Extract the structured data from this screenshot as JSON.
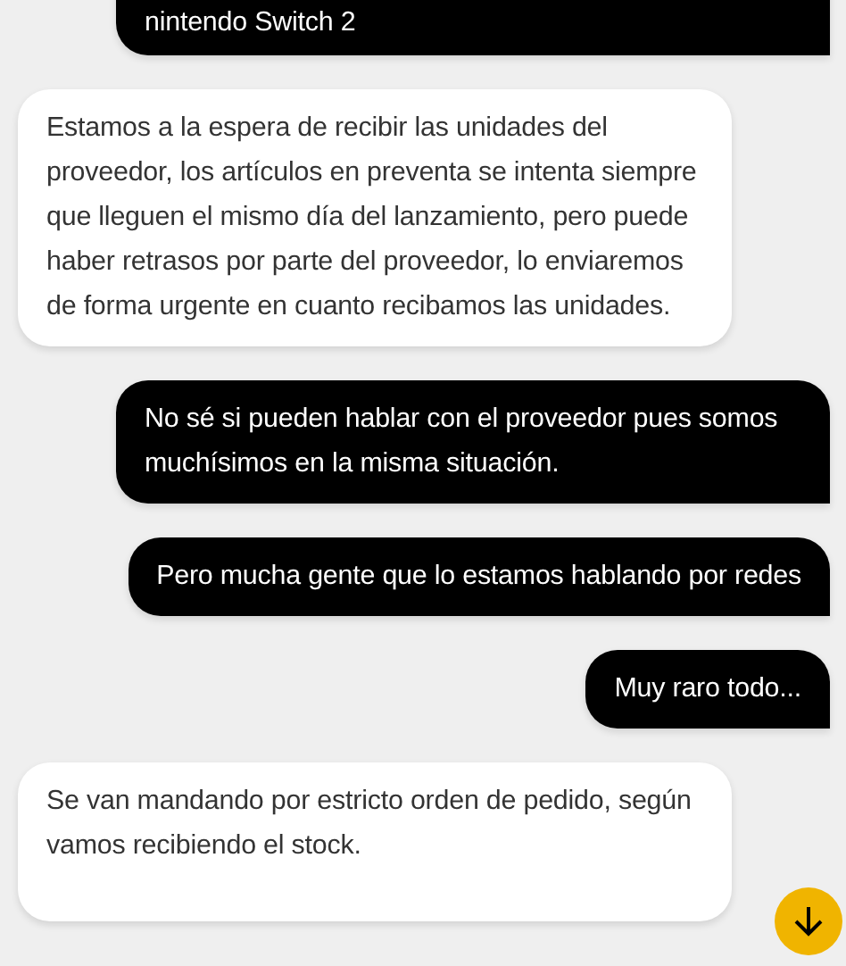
{
  "messages": [
    {
      "kind": "sent",
      "text": "nintendo Switch 2"
    },
    {
      "kind": "received",
      "text": "Estamos a la espera de recibir las unidades del proveedor, los artículos en preventa se intenta siempre que lleguen el mismo día del lanzamiento, pero puede haber retrasos por parte del proveedor, lo enviaremos de forma urgente en cuanto recibamos las unidades."
    },
    {
      "kind": "sent",
      "text": "No sé si pueden hablar con el proveedor pues somos muchísimos en la misma situación."
    },
    {
      "kind": "sent",
      "text": "Pero mucha gente que lo estamos hablando por redes"
    },
    {
      "kind": "sent",
      "text": "Muy raro todo..."
    },
    {
      "kind": "received",
      "text": "Se van mandando por estricto orden de pedido, según vamos recibiendo el stock."
    }
  ]
}
